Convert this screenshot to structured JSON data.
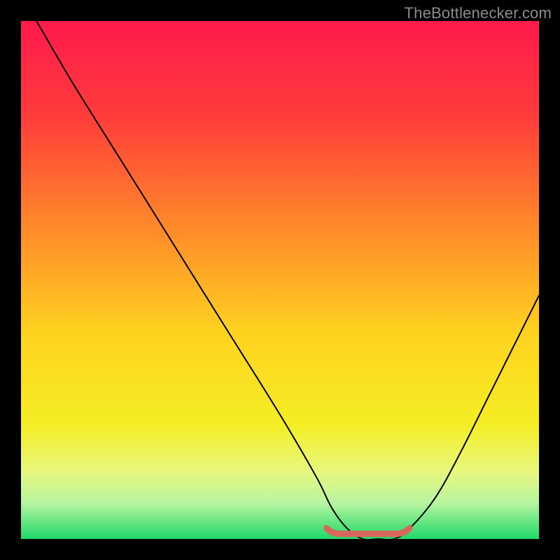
{
  "watermark": "TheBottlenecker.com",
  "chart_data": {
    "type": "line",
    "title": "",
    "xlabel": "",
    "ylabel": "",
    "xlim": [
      0,
      100
    ],
    "ylim": [
      0,
      100
    ],
    "series": [
      {
        "name": "bottleneck-curve",
        "x": [
          3,
          10,
          20,
          30,
          40,
          50,
          57,
          60,
          63,
          66,
          69,
          72,
          75,
          80,
          85,
          90,
          95,
          100
        ],
        "values": [
          100,
          88,
          72,
          56,
          40,
          24,
          12,
          6,
          2,
          0,
          0,
          0,
          2,
          8,
          17,
          27,
          37,
          47
        ]
      }
    ],
    "basin": {
      "x_start": 59,
      "x_end": 75,
      "y": 1
    },
    "gradient_stops": [
      {
        "offset": 0.0,
        "color": "#ff1a4d"
      },
      {
        "offset": 0.18,
        "color": "#ff3b3b"
      },
      {
        "offset": 0.4,
        "color": "#ff8a2a"
      },
      {
        "offset": 0.6,
        "color": "#ffd21f"
      },
      {
        "offset": 0.78,
        "color": "#f4ee25"
      },
      {
        "offset": 0.87,
        "color": "#e8f77e"
      },
      {
        "offset": 0.93,
        "color": "#b8f5a0"
      },
      {
        "offset": 1.0,
        "color": "#20d868"
      }
    ]
  }
}
